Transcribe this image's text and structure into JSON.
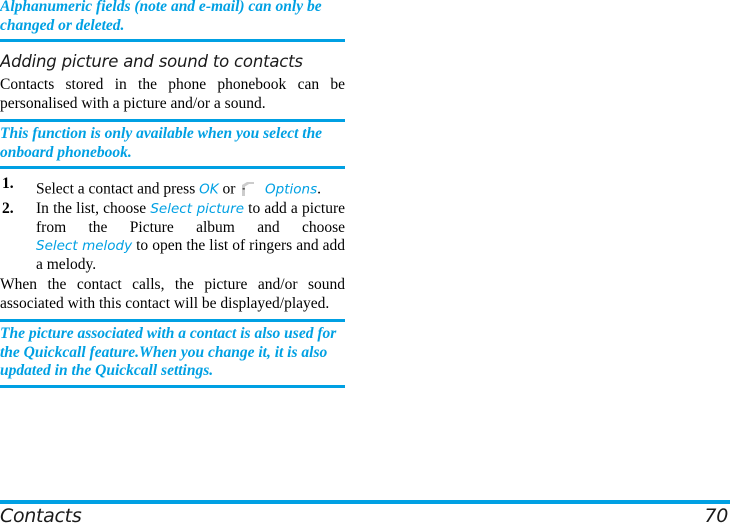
{
  "page": {
    "accent_color": "#00a0e3",
    "text_color": "#000000",
    "background_color": "#ffffff"
  },
  "notes": {
    "top": "Alphanumeric fields (note and e-mail) can only be changed or deleted.",
    "middle": "This function is only available when you select the onboard phonebook.",
    "bottom": "The picture associated with a contact is also used for the Quickcall feature.When you change it, it is also updated in the Quickcall settings."
  },
  "section": {
    "heading": "Adding picture and sound to contacts",
    "intro": "Contacts stored in the phone phonebook can be personalised with a picture and/or a sound.",
    "outro": "When the contact calls, the picture and/or sound associated with this contact will be displayed/played."
  },
  "steps": [
    {
      "number": "1.",
      "parts": [
        {
          "type": "text",
          "value": "Select a contact and press "
        },
        {
          "type": "ui",
          "value": "OK"
        },
        {
          "type": "text",
          "value": " or "
        },
        {
          "type": "icon",
          "value": "softkey-icon"
        },
        {
          "type": "text",
          "value": "  "
        },
        {
          "type": "ui",
          "value": "Options"
        },
        {
          "type": "text",
          "value": "."
        }
      ]
    },
    {
      "number": "2.",
      "parts": [
        {
          "type": "text",
          "value": "In the list, choose "
        },
        {
          "type": "ui",
          "value": "Select picture"
        },
        {
          "type": "text",
          "value": " to add a picture from the Picture album and choose "
        },
        {
          "type": "ui",
          "value": "Select melody"
        },
        {
          "type": "text",
          "value": " to open the list of ringers and add a melody."
        }
      ]
    }
  ],
  "step_labels": {
    "one": "1.",
    "two": "2.",
    "ok": "OK",
    "options": "Options",
    "select_picture": "Select picture",
    "select_melody": "Select melody",
    "step1_a": "Select a contact and press ",
    "step1_b": " or ",
    "step1_c": ".",
    "step2_a": "In the list, choose ",
    "step2_b": " to add a picture from the Picture album and choose ",
    "step2_c": " to open the list of ringers and add a melody."
  },
  "footer": {
    "chapter": "Contacts",
    "page_number": "70"
  }
}
